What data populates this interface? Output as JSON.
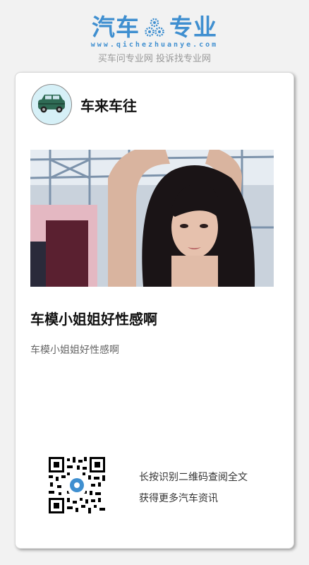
{
  "header": {
    "logo_left": "汽车",
    "logo_right": "专业",
    "logo_icon": "gear-icon",
    "url": "www.qichezhuanye.com",
    "slogan": "买车问专业网 投诉找专业网"
  },
  "card": {
    "source_avatar": "car-icon",
    "source_name": "车来车往",
    "image": "photo-of-woman",
    "title": "车模小姐姐好性感啊",
    "subtitle": "车模小姐姐好性感啊",
    "qr_code": "qr-code",
    "cta_line1": "长按识别二维码查阅全文",
    "cta_line2": "获得更多汽车资讯"
  },
  "colors": {
    "brand": "#3f8fd0",
    "background": "#f2f2f2",
    "card": "#ffffff"
  }
}
